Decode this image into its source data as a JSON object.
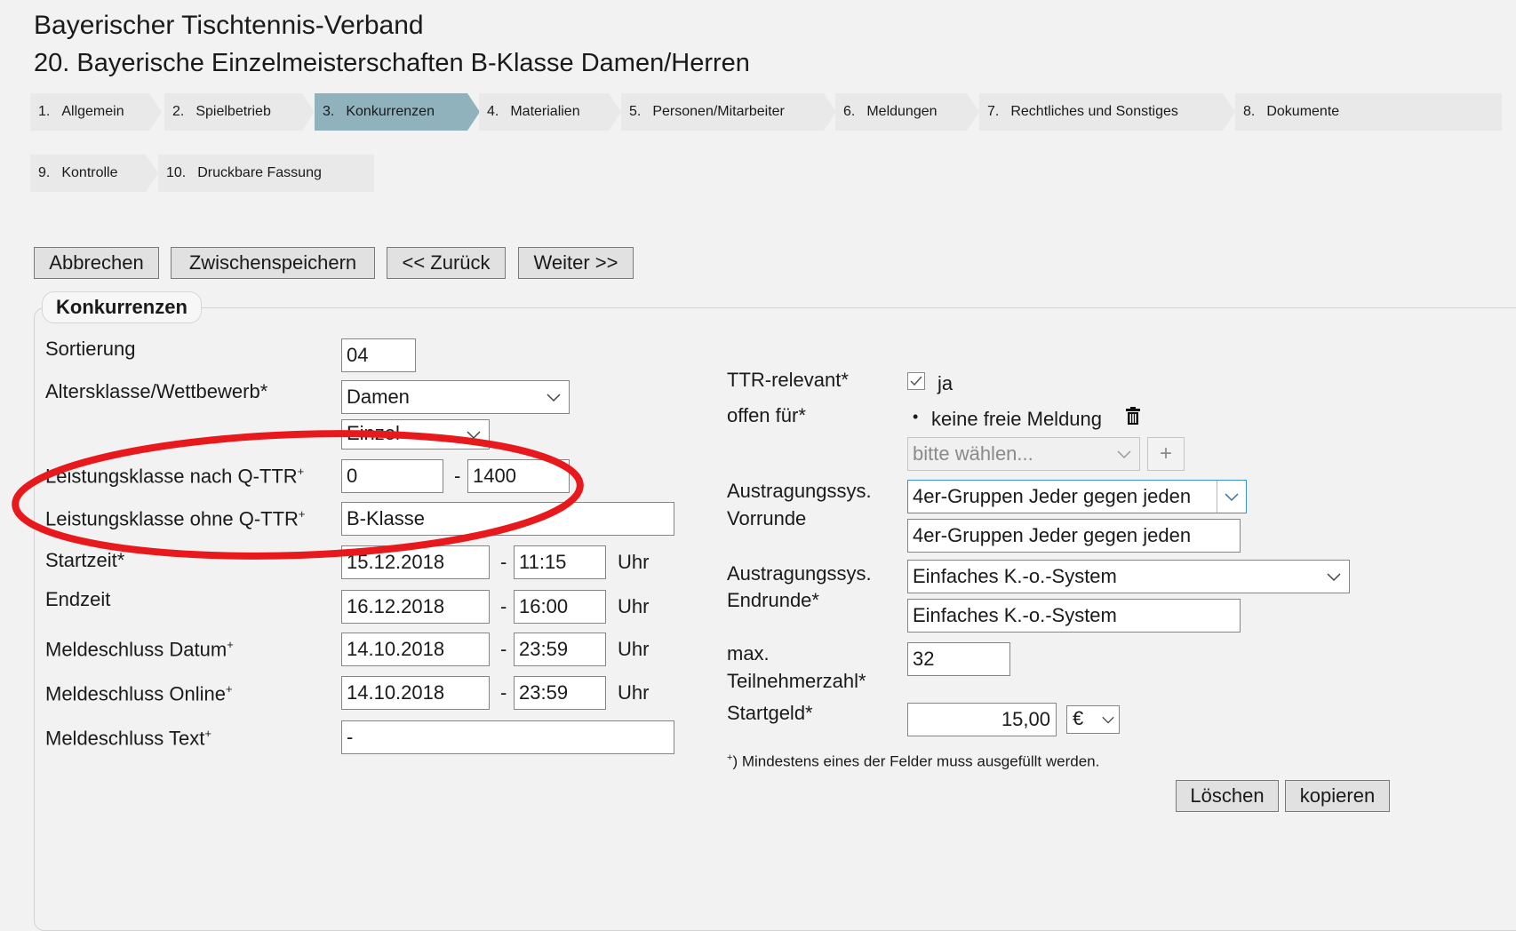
{
  "header": {
    "org": "Bayerischer Tischtennis-Verband",
    "event": "20. Bayerische Einzelmeisterschaften B-Klasse Damen/Herren"
  },
  "tabs": [
    {
      "num": "1.",
      "label": "Allgemein"
    },
    {
      "num": "2.",
      "label": "Spielbetrieb"
    },
    {
      "num": "3.",
      "label": "Konkurrenzen",
      "active": true
    },
    {
      "num": "4.",
      "label": "Materialien"
    },
    {
      "num": "5.",
      "label": "Personen/Mitarbeiter"
    },
    {
      "num": "6.",
      "label": "Meldungen"
    },
    {
      "num": "7.",
      "label": "Rechtliches und Sonstiges"
    },
    {
      "num": "8.",
      "label": "Dokumente"
    },
    {
      "num": "9.",
      "label": "Kontrolle"
    },
    {
      "num": "10.",
      "label": "Druckbare Fassung"
    }
  ],
  "buttons": {
    "cancel": "Abbrechen",
    "save": "Zwischenspeichern",
    "back": "<< Zurück",
    "next": "Weiter >>"
  },
  "section": {
    "title": "Konkurrenzen"
  },
  "form": {
    "sortierung": {
      "label": "Sortierung",
      "value": "04"
    },
    "altersklasse": {
      "label": "Altersklasse/Wettbewerb*",
      "value": "Damen",
      "sub_value": "Einzel"
    },
    "lk_qttr": {
      "label": "Leistungsklasse nach Q-TTR",
      "from": "0",
      "to": "1400"
    },
    "lk_ohne": {
      "label": "Leistungsklasse ohne Q-TTR",
      "value": "B-Klasse"
    },
    "startzeit": {
      "label": "Startzeit*",
      "date": "15.12.2018",
      "time": "11:15"
    },
    "endzeit": {
      "label": "Endzeit",
      "date": "16.12.2018",
      "time": "16:00"
    },
    "meldeschluss_datum": {
      "label": "Meldeschluss Datum",
      "date": "14.10.2018",
      "time": "23:59"
    },
    "meldeschluss_online": {
      "label": "Meldeschluss Online",
      "date": "14.10.2018",
      "time": "23:59"
    },
    "meldeschluss_text": {
      "label": "Meldeschluss Text",
      "value": "-"
    },
    "uhr": "Uhr",
    "dash": "-",
    "plus_mark": "+"
  },
  "right": {
    "ttr": {
      "label": "TTR-relevant*",
      "value": "ja",
      "checked": true
    },
    "offen": {
      "label": "offen für*",
      "item": "keine freie Meldung",
      "placeholder": "bitte wählen...",
      "add": "+"
    },
    "vorrunde": {
      "label1": "Austragungssys.",
      "label2": "Vorrunde",
      "select": "4er-Gruppen Jeder gegen jeden",
      "text": "4er-Gruppen Jeder gegen jeden"
    },
    "endrunde": {
      "label1": "Austragungssys.",
      "label2": "Endrunde*",
      "select": "Einfaches K.-o.-System",
      "text": "Einfaches K.-o.-System"
    },
    "max": {
      "label1": "max.",
      "label2": "Teilnehmerzahl*",
      "value": "32"
    },
    "startgeld": {
      "label": "Startgeld*",
      "value": "15,00",
      "currency": "€"
    },
    "note_mark": "+",
    "note": ") Mindestens eines der Felder muss ausgefüllt werden.",
    "delete": "Löschen",
    "copy": "kopieren"
  },
  "colors": {
    "active_tab": "#8fb2bd",
    "annotation": "#e8191c",
    "focus_border": "#3a8fd1"
  }
}
